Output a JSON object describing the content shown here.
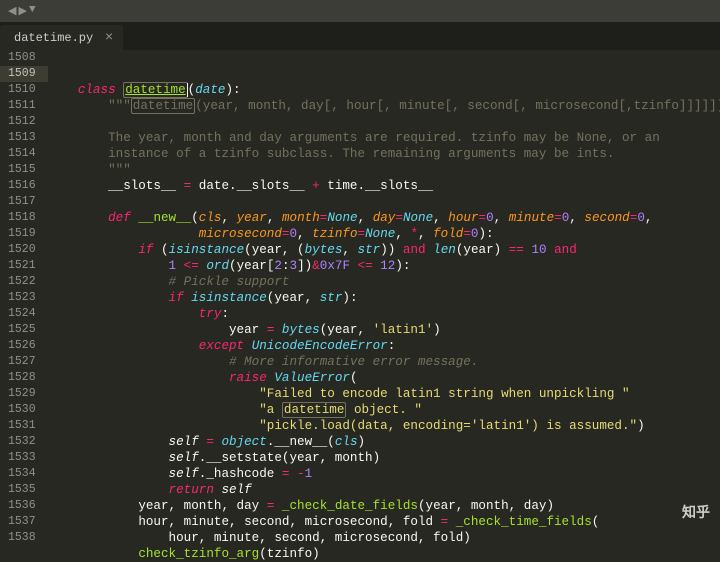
{
  "tab": {
    "filename": "datetime.py",
    "close": "×"
  },
  "nav": {
    "left": "◀",
    "right": "▶",
    "down": "▼"
  },
  "lines": [
    1508,
    1509,
    1510,
    1511,
    1512,
    1513,
    1514,
    1515,
    1516,
    1517,
    1518,
    1519,
    1520,
    1521,
    1522,
    1523,
    1524,
    1525,
    1526,
    1527,
    1528,
    1529,
    1530,
    1531,
    1532,
    1533,
    1534,
    1535,
    1536,
    1537,
    1538
  ],
  "current_line": 1509,
  "code": {
    "class_kw": "class",
    "class_name": "datetime",
    "base": "date",
    "doc1_a": "\"\"\"",
    "doc1_hl": "datetime",
    "doc1_b": "(year, month, day[, hour[, minute[, second[, microsecond[,tzinfo]]]]])",
    "doc2": "The year, month and day arguments are required. tzinfo may be None, or an",
    "doc3": "instance of a tzinfo subclass. The remaining arguments may be ints.",
    "doc_end": "\"\"\"",
    "slots_a": "__slots__ ",
    "slots_eq": "=",
    "slots_b": " date.__slots__ ",
    "slots_plus": "+",
    "slots_c": " time.__slots__",
    "def": "def",
    "new": "__new__",
    "a_cls": "cls",
    "a_year": "year",
    "a_month": "month",
    "a_day": "day",
    "a_hour": "hour",
    "a_minute": "minute",
    "a_second": "second",
    "a_micro": "microsecond",
    "a_tz": "tzinfo",
    "a_fold": "fold",
    "None": "None",
    "zero": "0",
    "star": "*",
    "if": "if",
    "isinstance": "isinstance",
    "bytes": "bytes",
    "str": "str",
    "and": "and",
    "len": "len",
    "ten": "10",
    "one": "1",
    "ord": "ord",
    "slice": "2",
    "slice3": "3",
    "mask": "0x7F",
    "twelve": "12",
    "cm_pickle": "# Pickle support",
    "try": "try",
    "latin1": "'latin1'",
    "except": "except",
    "uee": "UnicodeEncodeError",
    "cm_more": "# More informative error message.",
    "raise": "raise",
    "ve": "ValueError",
    "s1": "\"Failed to encode latin1 string when unpickling \"",
    "s2a": "\"a ",
    "s2hl": "datetime",
    "s2b": " object. \"",
    "s3": "\"pickle.load(data, encoding='latin1') is assumed.\"",
    "self": "self",
    "object": "object",
    "newcall": ".__new__(",
    "setstate": ".__setstate(year, month)",
    "hash": "._hashcode ",
    "neg1": "-",
    "n1": "1",
    "return": "return",
    "cdfn": "_check_date_fields",
    "cdfargs": "(year, month, day)",
    "ymd": "year, month, day ",
    "ctfn": "_check_time_fields",
    "hmsm": "hour, minute, second, microsecond, fold ",
    "ctfargs": "hour, minute, second, microsecond, fold)",
    "chktz": "check_tzinfo_arg",
    "chktzarg": "(tzinfo)"
  },
  "watermark": "知乎"
}
